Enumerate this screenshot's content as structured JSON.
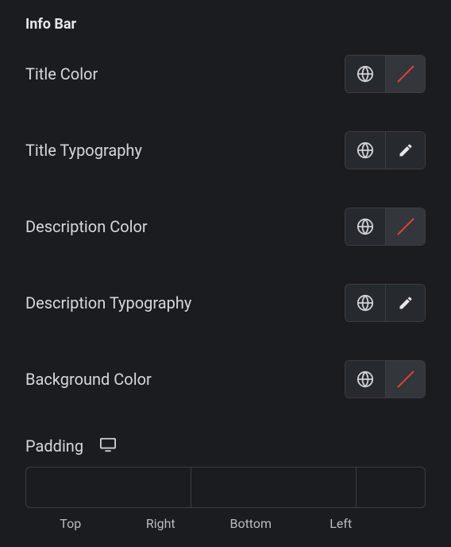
{
  "section": {
    "title": "Info Bar"
  },
  "rows": {
    "title_color": {
      "label": "Title Color",
      "type": "color",
      "value": null
    },
    "title_typography": {
      "label": "Title Typography",
      "type": "typography"
    },
    "description_color": {
      "label": "Description Color",
      "type": "color",
      "value": null
    },
    "description_typography": {
      "label": "Description Typography",
      "type": "typography"
    },
    "background_color": {
      "label": "Background Color",
      "type": "color",
      "value": null
    }
  },
  "padding": {
    "label": "Padding",
    "responsive": "desktop",
    "top": "",
    "right": "",
    "bottom": "",
    "left": "",
    "linked": true,
    "labels": {
      "top": "Top",
      "right": "Right",
      "bottom": "Bottom",
      "left": "Left"
    }
  },
  "icons": {
    "globe": "globe-icon",
    "pencil": "pencil-icon",
    "desktop": "desktop-icon",
    "link": "link-icon"
  }
}
